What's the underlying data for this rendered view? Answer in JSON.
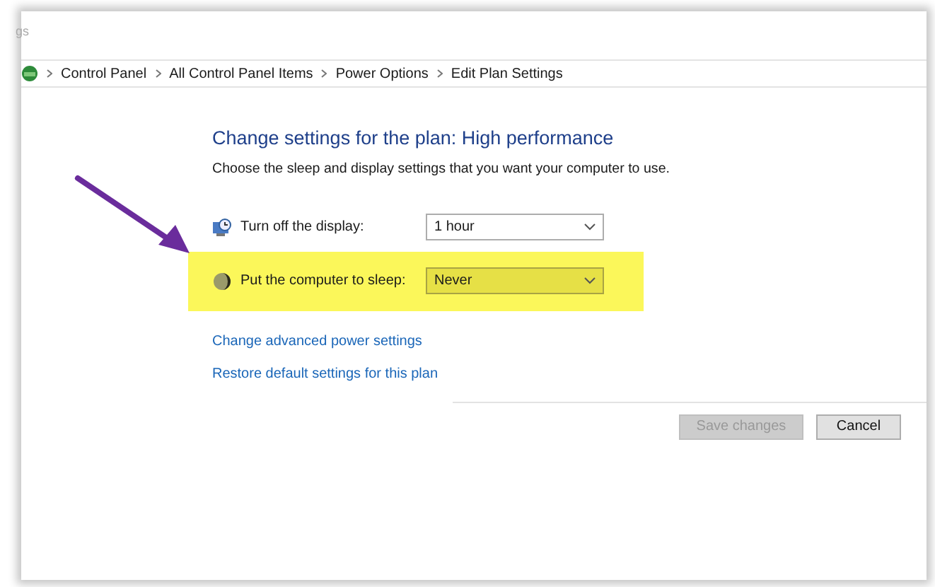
{
  "window": {
    "title": "gs"
  },
  "breadcrumb": [
    "Control Panel",
    "All Control Panel Items",
    "Power Options",
    "Edit Plan Settings"
  ],
  "heading": "Change settings for the plan: High performance",
  "description": "Choose the sleep and display settings that you want your computer to use.",
  "settings": [
    {
      "kind": "display",
      "label": "Turn off the display:",
      "value": "1 hour",
      "highlighted": false
    },
    {
      "kind": "sleep",
      "label": "Put the computer to sleep:",
      "value": "Never",
      "highlighted": true
    }
  ],
  "links": [
    "Change advanced power settings",
    "Restore default settings for this plan"
  ],
  "buttons": [
    {
      "label": "Save changes",
      "disabled": true
    },
    {
      "label": "Cancel",
      "disabled": false
    }
  ],
  "annotation_arrow": true
}
